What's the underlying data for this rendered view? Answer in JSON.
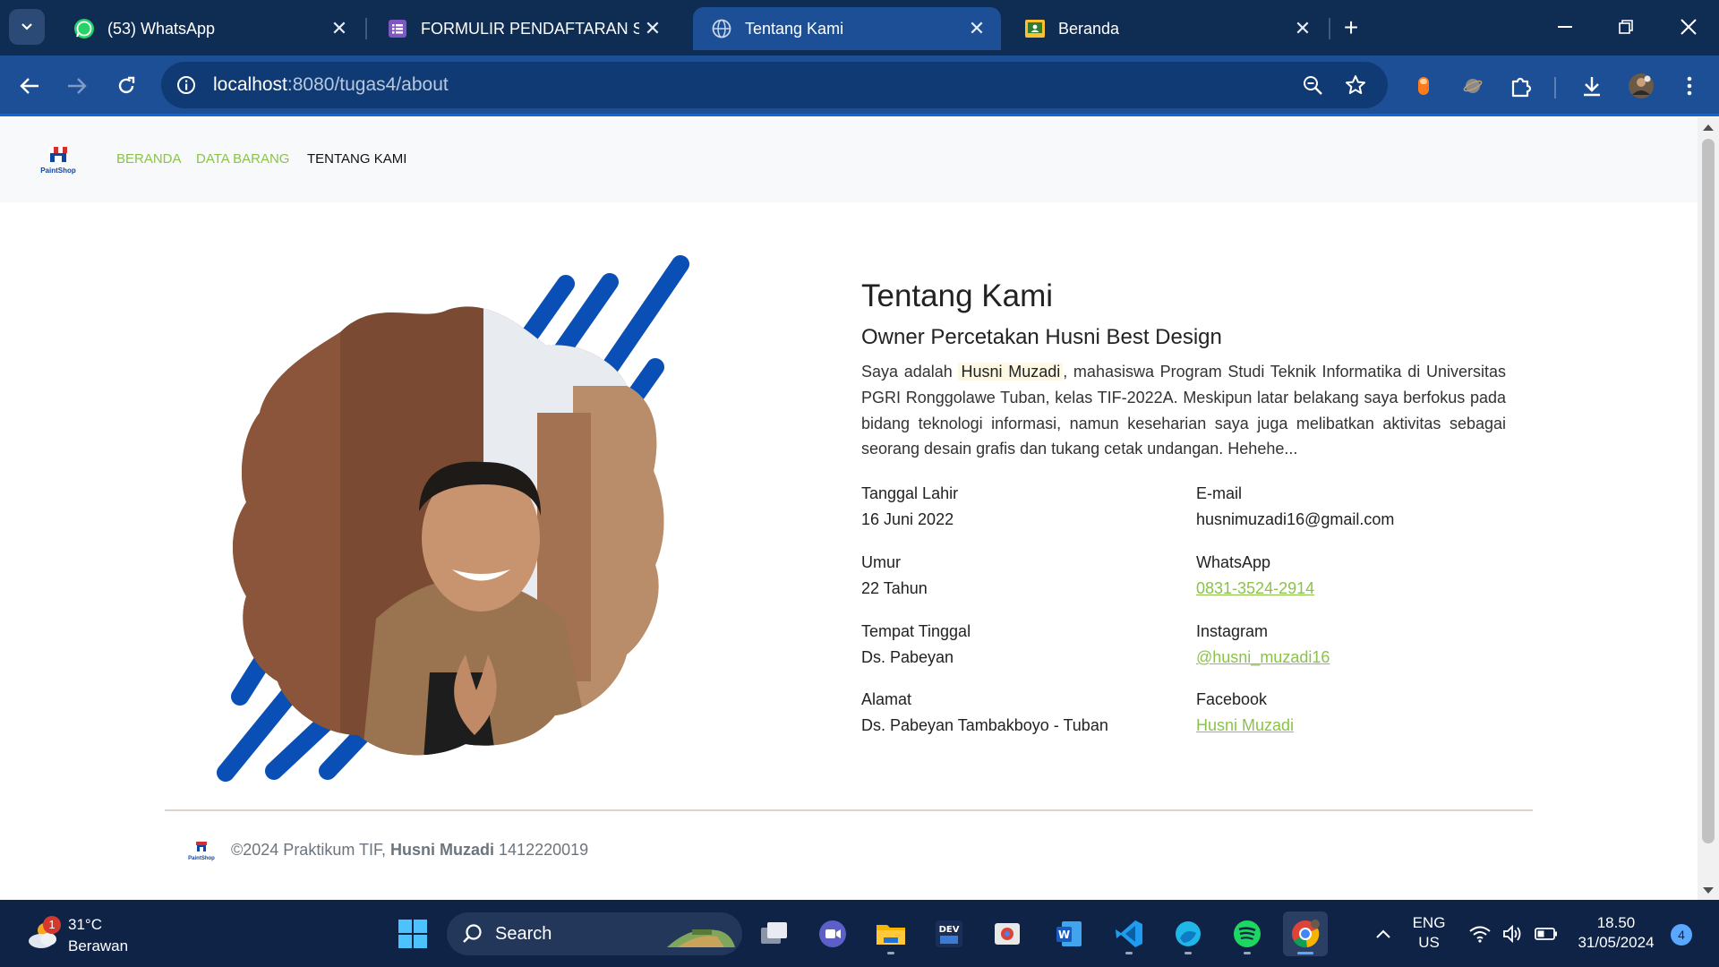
{
  "browser": {
    "tabs": [
      {
        "title": "(53) WhatsApp",
        "icon": "whatsapp-icon",
        "active": false
      },
      {
        "title": "FORMULIR PENDAFTARAN SMP",
        "icon": "google-forms-icon",
        "active": false
      },
      {
        "title": "Tentang Kami",
        "icon": "globe-icon",
        "active": true
      },
      {
        "title": "Beranda",
        "icon": "google-classroom-icon",
        "active": false
      }
    ],
    "url_host": "localhost",
    "url_path": ":8080/tugas4/about"
  },
  "site": {
    "nav": {
      "logo_text": "PaintShop",
      "items": [
        "BERANDA",
        "DATA BARANG",
        "TENTANG KAMI"
      ]
    },
    "about": {
      "title": "Tentang Kami",
      "subtitle": "Owner Percetakan Husni Best Design",
      "desc_before": "Saya adalah ",
      "desc_name": "Husni Muzadi",
      "desc_after": ", mahasiswa Program Studi Teknik Informatika di Universitas PGRI Ronggolawe Tuban, kelas TIF-2022A. Meskipun latar belakang saya berfokus pada bidang teknologi informasi, namun keseharian saya juga melibatkan aktivitas sebagai seorang desain grafis dan tukang cetak undangan. Hehehe..."
    },
    "info": {
      "dob_label": "Tanggal Lahir",
      "dob": "16 Juni 2022",
      "age_label": "Umur",
      "age": "22 Tahun",
      "residence_label": "Tempat Tinggal",
      "residence": "Ds. Pabeyan",
      "address_label": "Alamat",
      "address": "Ds. Pabeyan Tambakboyo - Tuban",
      "email_label": "E-mail",
      "email": "husnimuzadi16@gmail.com",
      "whatsapp_label": "WhatsApp",
      "whatsapp": "0831-3524-2914",
      "instagram_label": "Instagram",
      "instagram": "@husni_muzadi16",
      "facebook_label": "Facebook",
      "facebook": "Husni Muzadi"
    },
    "footer": {
      "prefix": "©2024 Praktikum TIF,",
      "name": "Husni Muzadi",
      "nim": "1412220019"
    },
    "colors": {
      "accent_green": "#8bc34a",
      "stripe_blue": "#0a4fb5"
    }
  },
  "taskbar": {
    "weather_temp": "31°C",
    "weather_cond": "Berawan",
    "weather_badge": "1",
    "search_placeholder": "Search",
    "lang_1": "ENG",
    "lang_2": "US",
    "time": "18.50",
    "date": "31/05/2024",
    "notifications": "4"
  }
}
